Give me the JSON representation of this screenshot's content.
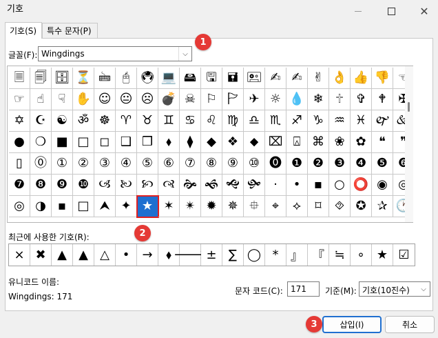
{
  "window": {
    "title": "기호",
    "minimize_icon": "minimize-icon",
    "maximize_icon": "maximize-icon",
    "close_icon": "close-icon"
  },
  "tabs": [
    {
      "label": "기호(S)"
    },
    {
      "label": "특수 문자(P)"
    }
  ],
  "font": {
    "label": "글꼴(F):",
    "value": "Wingdings"
  },
  "symbols": [
    "🗏",
    "🗐",
    "🗄",
    "⏳",
    "🖮",
    "🖰",
    "🖲",
    "💻",
    "🖴",
    "🖫",
    "🖬",
    "🖭",
    "✍",
    "✍",
    "✌",
    "👌",
    "👍",
    "👎",
    "☜",
    "☞",
    "☝",
    "☟",
    "✋",
    "☺",
    "😐",
    "☹",
    "💣",
    "☠",
    "⚐",
    "🏱",
    "✈",
    "☼",
    "💧",
    "❄",
    "🕆",
    "✞",
    "🕈",
    "✠",
    "✡",
    "☪",
    "☯",
    "ॐ",
    "☸",
    "♈",
    "♉",
    "♊",
    "♋",
    "♌",
    "♍",
    "♎",
    "♏",
    "♐",
    "♑",
    "♒",
    "♓",
    "🙰",
    "🙵",
    "●",
    "❍",
    "■",
    "□",
    "◻",
    "❑",
    "❒",
    "⬧",
    "⧫",
    "◆",
    "❖",
    "⬥",
    "⌧",
    "⍓",
    "⌘",
    "❀",
    "✿",
    "❝",
    "❞",
    "▯",
    "⓪",
    "①",
    "②",
    "③",
    "④",
    "⑤",
    "⑥",
    "⑦",
    "⑧",
    "⑨",
    "⑩",
    "⓿",
    "❶",
    "❷",
    "❸",
    "❹",
    "❺",
    "❻",
    "❼",
    "❽",
    "❾",
    "❿",
    "🙢",
    "🙠",
    "🙡",
    "🙣",
    "🙞",
    "🙜",
    "🙝",
    "🙟",
    "·",
    "•",
    "▪",
    "○",
    "⭕",
    "◉",
    "◎",
    "◎",
    "◑",
    "▪",
    "□",
    "⮝",
    "✦",
    "★",
    "✶",
    "✴",
    "✹",
    "✵",
    "⯐",
    "⌖",
    "⟡",
    "⌑",
    "⯑",
    "✪",
    "✰",
    "🕐"
  ],
  "recent": {
    "label": "최근에 사용한 기호(R):",
    "items": [
      "×",
      "✖",
      "▲",
      "▲",
      "△",
      "•",
      "→",
      "⬧",
      "🡒",
      "±",
      "∑",
      "◯",
      "*",
      "』",
      "『",
      "≒",
      "∘",
      "★",
      "☑"
    ]
  },
  "unicode": {
    "label": "유니코드 이름:",
    "value": "Wingdings: 171"
  },
  "char_code": {
    "label": "문자 코드(C):",
    "value": "171"
  },
  "standard": {
    "label": "기준(M):",
    "value": "기호(10진수)"
  },
  "buttons": {
    "insert": "삽입(I)",
    "cancel": "취소"
  },
  "callouts": [
    "1",
    "2",
    "3"
  ],
  "selected_symbol": "★"
}
